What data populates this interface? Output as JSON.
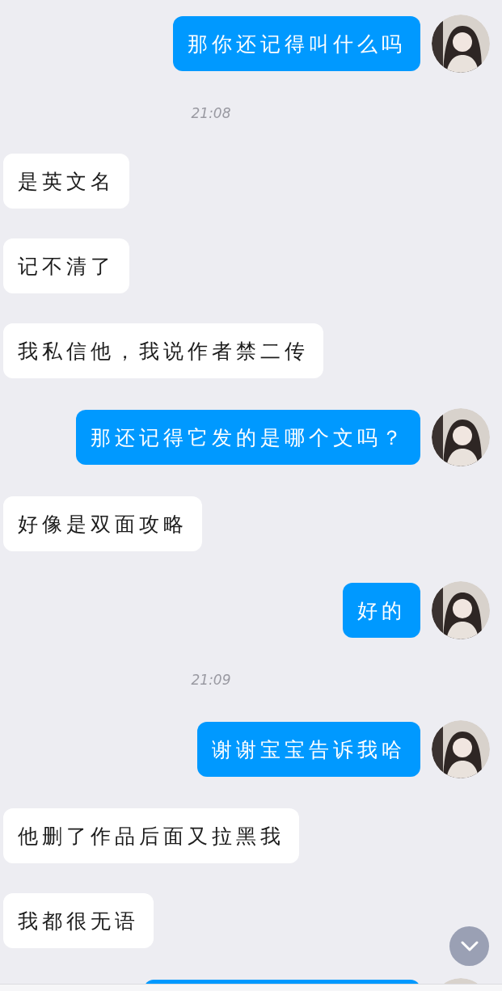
{
  "messages": [
    {
      "kind": "outgoing",
      "text": "那你还记得叫什么吗"
    },
    {
      "kind": "time",
      "text": "21:08"
    },
    {
      "kind": "incoming",
      "text": "是英文名"
    },
    {
      "kind": "incoming",
      "text": "记不清了"
    },
    {
      "kind": "incoming",
      "text": "我私信他，我说作者禁二传"
    },
    {
      "kind": "outgoing",
      "text": "那还记得它发的是哪个文吗？"
    },
    {
      "kind": "incoming",
      "text": "好像是双面攻略"
    },
    {
      "kind": "outgoing",
      "text": "好的"
    },
    {
      "kind": "time",
      "text": "21:09"
    },
    {
      "kind": "outgoing",
      "text": "谢谢宝宝告诉我哈"
    },
    {
      "kind": "incoming",
      "text": "他删了作品后面又拉黑我"
    },
    {
      "kind": "incoming",
      "text": "我都很无语"
    },
    {
      "kind": "outgoing_cut"
    }
  ]
}
